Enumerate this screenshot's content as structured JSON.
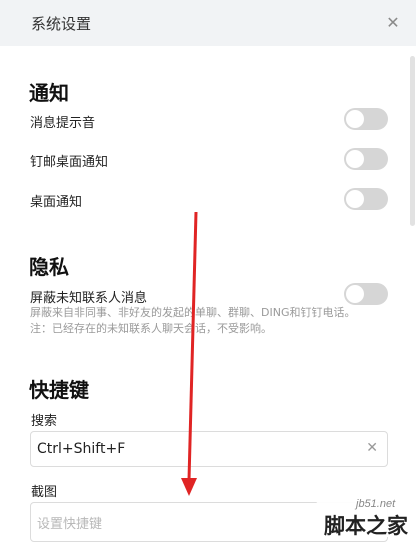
{
  "window": {
    "title": "系统设置",
    "close_icon": "close-icon"
  },
  "notifications": {
    "heading": "通知",
    "items": [
      {
        "label": "消息提示音",
        "enabled": false
      },
      {
        "label": "钉邮桌面通知",
        "enabled": false
      },
      {
        "label": "桌面通知",
        "enabled": false
      }
    ]
  },
  "privacy": {
    "heading": "隐私",
    "item_label": "屏蔽未知联系人消息",
    "enabled": false,
    "desc_line1": "屏蔽来自非同事、非好友的发起的单聊、群聊、DING和钉钉电话。",
    "desc_line2": "注：已经存在的未知联系人聊天会话，不受影响。"
  },
  "shortcuts": {
    "heading": "快捷键",
    "search_label": "搜索",
    "search_value": "Ctrl+Shift+F",
    "screenshot_label": "截图",
    "screenshot_placeholder": "设置快捷键"
  },
  "watermark": {
    "host": "jb51.net",
    "name": "脚本之家"
  },
  "colors": {
    "toggle_off": "#d6d6d6",
    "arrow": "#e02424",
    "titlebar": "#f1f3f5"
  }
}
